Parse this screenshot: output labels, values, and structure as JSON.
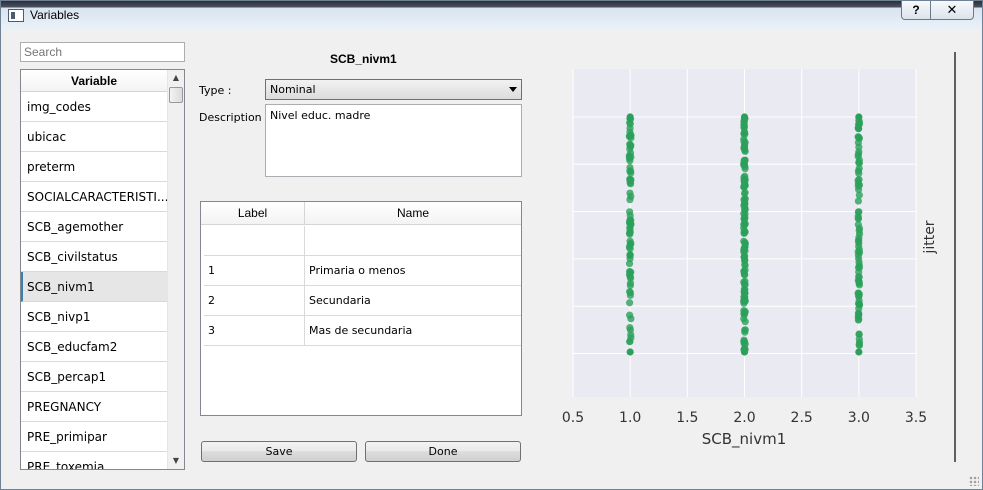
{
  "window": {
    "title": "Variables",
    "help_label": "?",
    "close_label": "✕"
  },
  "search": {
    "placeholder": "Search"
  },
  "variable_list": {
    "header": "Variable",
    "items": [
      "img_codes",
      "ubicac",
      "preterm",
      "SOCIALCARACTERISTI...",
      "SCB_agemother",
      "SCB_civilstatus",
      "SCB_nivm1",
      "SCB_nivp1",
      "SCB_educfam2",
      "SCB_percap1",
      "PREGNANCY",
      "PRE_primipar",
      "PRE_toxemia"
    ],
    "selected": "SCB_nivm1"
  },
  "detail": {
    "variable_name": "SCB_nivm1",
    "type_label": "Type :",
    "type_value": "Nominal",
    "description_label": "Description :",
    "description_value": "Nivel educ. madre"
  },
  "label_table": {
    "headers": [
      "Label",
      "Name"
    ],
    "rows": [
      {
        "label": "",
        "name": ""
      },
      {
        "label": "1",
        "name": "Primaria o menos"
      },
      {
        "label": "2",
        "name": "Secundaria"
      },
      {
        "label": "3",
        "name": "Mas de secundaria"
      }
    ]
  },
  "buttons": {
    "save": "Save",
    "done": "Done"
  },
  "colors": {
    "points": "#2ca05a",
    "plot_bg": "#eaeaf2",
    "grid": "#ffffff"
  },
  "chart_data": {
    "type": "scatter",
    "xlabel": "SCB_nivm1",
    "ylabel": "jitter",
    "xlim": [
      0.5,
      3.5
    ],
    "ylim": [
      0,
      1
    ],
    "xticks": [
      "0.5",
      "1.0",
      "1.5",
      "2.0",
      "2.5",
      "3.0",
      "3.5"
    ],
    "grid": true,
    "series": [
      {
        "x": 1.0,
        "y_range": [
          0.0,
          1.0
        ]
      },
      {
        "x": 2.0,
        "y_range": [
          0.0,
          1.0
        ]
      },
      {
        "x": 3.0,
        "y_range": [
          0.0,
          1.0
        ]
      }
    ]
  }
}
